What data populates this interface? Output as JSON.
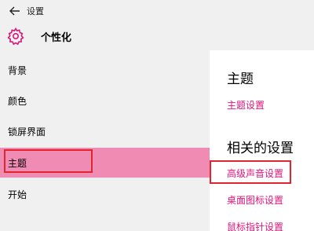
{
  "window": {
    "title": "设置"
  },
  "header": {
    "title": "个性化"
  },
  "sidebar": {
    "items": [
      {
        "label": "背景"
      },
      {
        "label": "颜色"
      },
      {
        "label": "锁屏界面"
      },
      {
        "label": "主题"
      },
      {
        "label": "开始"
      }
    ],
    "selected": "主题"
  },
  "main": {
    "heading": "主题",
    "theme_settings_link": "主题设置",
    "related_heading": "相关的设置",
    "related_links": [
      {
        "label": "高级声音设置"
      },
      {
        "label": "桌面图标设置"
      },
      {
        "label": "鼠标指针设置"
      }
    ]
  },
  "colors": {
    "accent": "#e2137a",
    "selected_bg": "#f08bb3",
    "highlight_border": "#e0252e"
  },
  "icons": {
    "back": "back-arrow-icon",
    "settings": "gear-icon"
  }
}
